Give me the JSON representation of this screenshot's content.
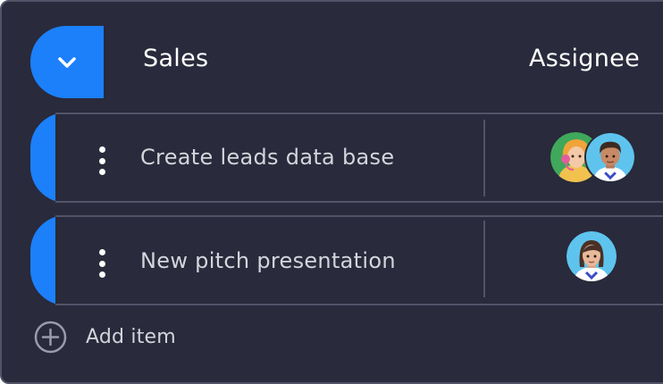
{
  "group": {
    "title": "Sales",
    "column_header": "Assignee",
    "accent_color": "#1c80fb",
    "collapse_icon": "chevron-down-icon"
  },
  "rows": [
    {
      "label": "Create leads data base",
      "assignees": [
        {
          "icon": "avatar-woman-headset",
          "bg": "#3fa85b"
        },
        {
          "icon": "avatar-man-curly-hair",
          "bg": "#5ec4ee"
        }
      ]
    },
    {
      "label": "New pitch presentation",
      "assignees": [
        {
          "icon": "avatar-woman-long-hair",
          "bg": "#5ec4ee"
        }
      ]
    }
  ],
  "footer": {
    "add_label": "Add item",
    "add_icon": "plus-circle-icon"
  }
}
